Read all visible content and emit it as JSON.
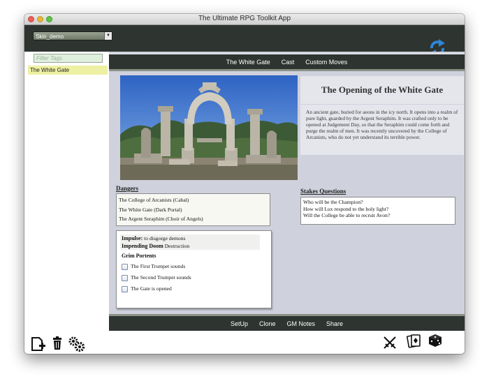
{
  "window": {
    "title": "The Ultimate RPG Toolkit App"
  },
  "toolbar": {
    "skin_value": "Skin_demo",
    "refresh_icon": "refresh-arrows-icon",
    "accent": "#2d86d8"
  },
  "sidebar": {
    "filter_placeholder": "Filter Tags",
    "items": [
      {
        "label": "The White Gate"
      }
    ]
  },
  "top_nav": {
    "items": [
      {
        "label": "The White Gate"
      },
      {
        "label": "Cast"
      },
      {
        "label": "Custom Moves"
      }
    ]
  },
  "front": {
    "title": "The Opening of the White Gate",
    "description": "An ancient gate, buried for aeons in the icy north. It opens into a realm of pure light, guarded by the Argent Seraphim. It was crafted only to be opened at Judgement Day, so that the Seraphim could come forth and purge the realm of men. It was recently uncovered by the College of Arcanists, who do not yet understand its terrible power.",
    "dangers_heading": "Dangers",
    "dangers": [
      "The College of Arcanists (Cabal)",
      "The White Gate (Dark Portal)",
      "The Argent Seraphim (Choir of Angels)"
    ],
    "stakes_heading": "Stakes Questions",
    "stakes": [
      "Who will be the Champion?",
      "How will Lux respond to the holy light?",
      "Will the College be able to recruit Avon?"
    ],
    "impulse_label": "Impulse:",
    "impulse_value": "to disgorge demons",
    "doom_label": "Impending Doom",
    "doom_value": "Destruction",
    "portents_heading": "Grim Portents",
    "portents": [
      {
        "label": "The First Trumpet sounds",
        "checked": false
      },
      {
        "label": "The Second Trumpet sounds",
        "checked": false
      },
      {
        "label": "The Gate is opened",
        "checked": false
      }
    ]
  },
  "bottom_nav": {
    "items": [
      {
        "label": "SetUp"
      },
      {
        "label": "Clone"
      },
      {
        "label": "GM Notes"
      },
      {
        "label": "Share"
      }
    ]
  },
  "footer": {
    "left_icons": [
      "new-document-icon",
      "trash-icon",
      "settings-gears-icon"
    ],
    "right_icons": [
      "crossed-swords-icon",
      "card-deck-icon",
      "dice-icon"
    ]
  }
}
